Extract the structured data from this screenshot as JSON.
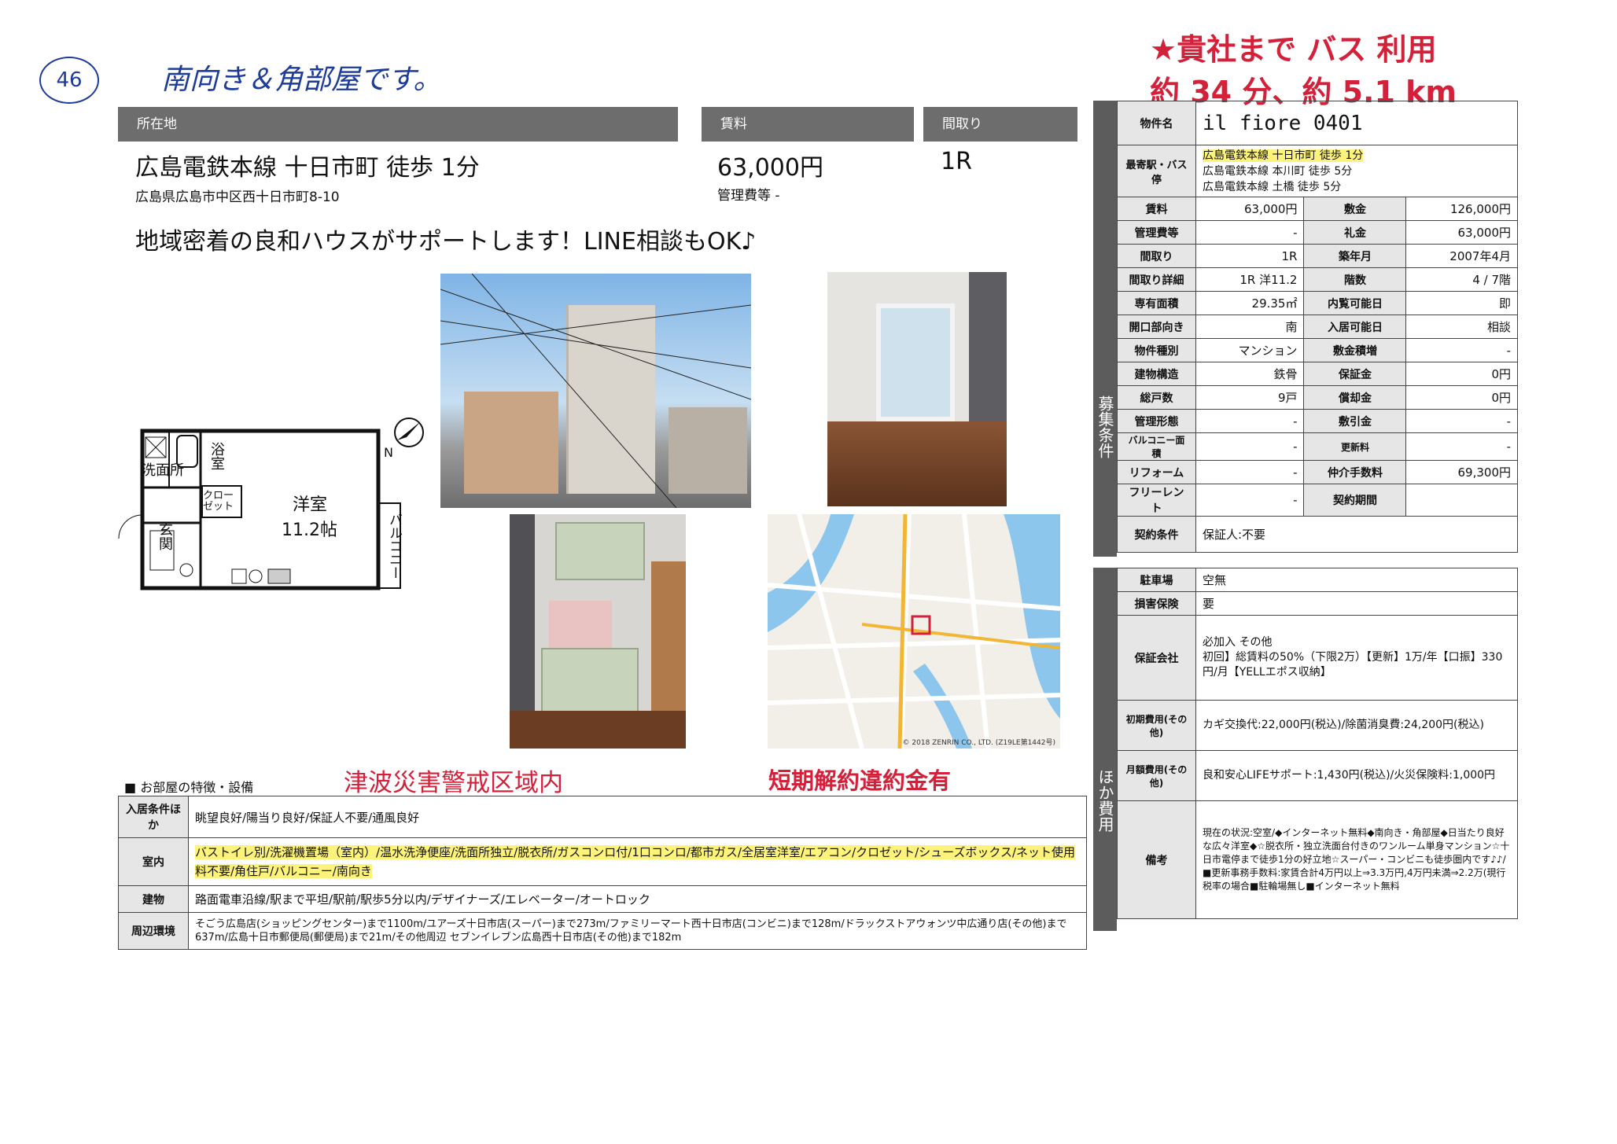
{
  "annotations": {
    "circle_number": "46",
    "top_note": "南向き＆角部屋です。",
    "bus_note_line1": "★貴社まで バス 利用",
    "bus_note_line2": "約 34 分、約 5.1 km",
    "tsunami_note": "津波災害警戒区域内",
    "penalty_note": "短期解約違約金有"
  },
  "header": {
    "location_label": "所在地",
    "rent_label": "賃料",
    "layout_label": "間取り",
    "station": "広島電鉄本線 十日市町 徒歩 1分",
    "address": "広島県広島市中区西十日市町8-10",
    "rent": "63,000円",
    "mgmt_fee": "管理費等 -",
    "layout": "1R"
  },
  "catchphrase": "地域密着の良和ハウスがサポートします！LINE相談もOK♪",
  "floorplan": {
    "bath": "浴室",
    "washroom": "洗面所",
    "closet": "クローゼット",
    "room": "洋室",
    "room_size": "11.2帖",
    "entrance": "玄関",
    "balcony": "バルコニー",
    "north": "N"
  },
  "map_credit": "© 2018 ZENRIN CO., LTD. (Z19LE第1442号)",
  "side_labels": {
    "recruit": "募集条件",
    "other_costs": "ほか費用"
  },
  "conditions": {
    "property_name_label": "物件名",
    "property_name": "il fiore 0401",
    "nearest_label": "最寄駅・バス停",
    "nearest": [
      "広島電鉄本線 十日市町 徒歩 1分",
      "広島電鉄本線 本川町 徒歩 5分",
      "広島電鉄本線 土橋 徒歩 5分"
    ],
    "rows": [
      [
        "賃料",
        "63,000円",
        "敷金",
        "126,000円"
      ],
      [
        "管理費等",
        "-",
        "礼金",
        "63,000円"
      ],
      [
        "間取り",
        "1R",
        "築年月",
        "2007年4月"
      ],
      [
        "間取り詳細",
        "1R 洋11.2",
        "階数",
        "4 / 7階"
      ],
      [
        "専有面積",
        "29.35㎡",
        "内覧可能日",
        "即"
      ],
      [
        "開口部向き",
        "南",
        "入居可能日",
        "相談"
      ],
      [
        "物件種別",
        "マンション",
        "敷金積増",
        "-"
      ],
      [
        "建物構造",
        "鉄骨",
        "保証金",
        "0円"
      ],
      [
        "総戸数",
        "9戸",
        "償却金",
        "0円"
      ],
      [
        "管理形態",
        "-",
        "敷引金",
        "-"
      ],
      [
        "バルコニー面積",
        "-",
        "更新料",
        "-"
      ],
      [
        "リフォーム",
        "-",
        "仲介手数料",
        "69,300円"
      ],
      [
        "フリーレント",
        "-",
        "契約期間",
        ""
      ]
    ],
    "contract_label": "契約条件",
    "contract": "保証人:不要"
  },
  "costs": {
    "parking_label": "駐車場",
    "parking": "空無",
    "insurance_label": "損害保険",
    "insurance": "要",
    "guarantee_label": "保証会社",
    "guarantee": "必加入 その他\n初回】総賃料の50%（下限2万）【更新】1万/年【口振】330円/月【YELLエポス収納】",
    "initial_label": "初期費用(その他)",
    "initial": "カギ交換代:22,000円(税込)/除菌消臭費:24,200円(税込)",
    "monthly_label": "月額費用(その他)",
    "monthly": "良和安心LIFEサポート:1,430円(税込)/火災保険料:1,000円",
    "remarks_label": "備考",
    "remarks": "現在の状況:空室/◆インターネット無料◆南向き・角部屋◆日当たり良好な広々洋室◆☆脱衣所・独立洗面台付きのワンルーム単身マンション☆十日市電停まで徒歩1分の好立地☆スーパー・コンビニも徒歩圏内です♪♪/■更新事務手数料:家賃合計4万円以上⇒3.3万円,4万円未満⇒2.2万(現行税率の場合■駐輪場無し■インターネット無料"
  },
  "features": {
    "section_title": "■ お部屋の特徴・設備",
    "rows": [
      {
        "label": "入居条件ほか",
        "value": "眺望良好/陽当り良好/保証人不要/通風良好"
      },
      {
        "label": "室内",
        "value": "バストイレ別/洗濯機置場（室内）/温水洗浄便座/洗面所独立/脱衣所/ガスコンロ付/1口コンロ/都市ガス/全居室洋室/エアコン/クロゼット/シューズボックス/ネット使用料不要/角住戸/バルコニー/南向き"
      },
      {
        "label": "建物",
        "value": "路面電車沿線/駅まで平坦/駅前/駅歩5分以内/デザイナーズ/エレベーター/オートロック"
      },
      {
        "label": "周辺環境",
        "value": "そごう広島店(ショッピングセンター)まで1100m/ユアーズ十日市店(スーパー)まで273m/ファミリーマート西十日市店(コンビニ)まで128m/ドラックストアウォンツ中広通り店(その他)まで637m/広島十日市郵便局(郵便局)まで21m/その他周辺 セブンイレブン広島西十日市店(その他)まで182m"
      }
    ]
  }
}
